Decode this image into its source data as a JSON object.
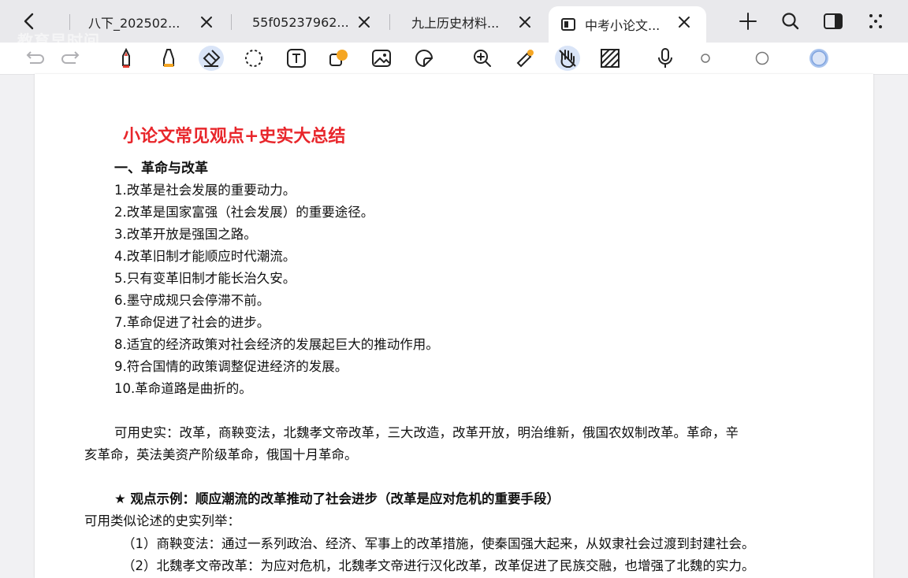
{
  "tabs": [
    {
      "label": "八下_202502..."
    },
    {
      "label": "55f05237962..."
    },
    {
      "label": "九上历史材料..."
    },
    {
      "label": "中考小论文..."
    }
  ],
  "watermark": "教育早时间",
  "document": {
    "title": "小论文常见观点+史实大总结",
    "section1": "一、革命与改革",
    "points": [
      "1.改革是社会发展的重要动力。",
      "2.改革是国家富强（社会发展）的重要途径。",
      "3.改革开放是强国之路。",
      "4.改革旧制才能顺应时代潮流。",
      "5.只有变革旧制才能长治久安。",
      "6.墨守成规只会停滞不前。",
      "7.革命促进了社会的进步。",
      "8.适宜的经济政策对社会经济的发展起巨大的推动作用。",
      "9.符合国情的政策调整促进经济的发展。",
      "10.革命道路是曲折的。"
    ],
    "facts_line1": "可用史实：改革，商鞅变法，北魏孝文帝改革，三大改造，改革开放，明治维新，俄国农奴制改革。革命，辛",
    "facts_line2": "亥革命，英法美资产阶级革命，俄国十月革命。",
    "example_heading": "★ 观点示例：顺应潮流的改革推动了社会进步（改革是应对危机的重要手段）",
    "example_intro": "可用类似论述的史实列举：",
    "example_item1": "（1）商鞅变法：通过一系列政治、经济、军事上的改革措施，使秦国强大起来，从奴隶社会过渡到封建社会。",
    "example_item2": "（2）北魏孝文帝改革：为应对危机，北魏孝文帝进行汉化改革，改革促进了民族交融，也增强了北魏的实力。"
  }
}
